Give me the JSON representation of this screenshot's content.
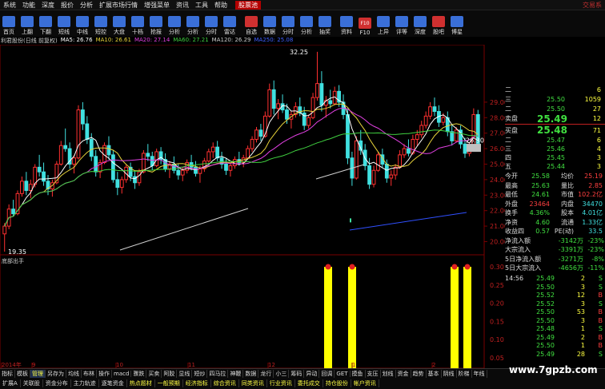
{
  "menu": {
    "items": [
      "系统",
      "功能",
      "深度",
      "报价",
      "分析",
      "扩展市场行情",
      "增强菜单",
      "资讯",
      "工具",
      "帮助"
    ],
    "active": "股票池",
    "right": "交易系"
  },
  "toolbar": {
    "buttons": [
      {
        "label": "首页",
        "icon": "home-icon",
        "color": "#3a6fd8"
      },
      {
        "label": "上翻",
        "icon": "arrow-up-icon",
        "color": "#3a6fd8"
      },
      {
        "label": "下翻",
        "icon": "arrow-down-icon",
        "color": "#3a6fd8"
      },
      {
        "label": "短线",
        "icon": "ruler-icon",
        "color": "#3a6fd8"
      },
      {
        "label": "中线",
        "icon": "chart-icon",
        "color": "#3a6fd8"
      },
      {
        "label": "短控",
        "icon": "chart-icon",
        "color": "#3a6fd8"
      },
      {
        "label": "大盘",
        "icon": "chart-icon",
        "color": "#3a6fd8"
      },
      {
        "label": "十档",
        "icon": "grid-icon",
        "color": "#3a6fd8"
      },
      {
        "label": "抢报",
        "icon": "flash-icon",
        "color": "#3a6fd8"
      },
      {
        "label": "分析",
        "icon": "kline-icon",
        "color": "#3a6fd8"
      },
      {
        "label": "分析",
        "icon": "pie-icon",
        "color": "#3a6fd8"
      },
      {
        "label": "分时",
        "icon": "clock-icon",
        "color": "#3a6fd8"
      },
      {
        "label": "雷达",
        "icon": "radar-icon",
        "color": "#3a6fd8"
      },
      {
        "label": "自选",
        "icon": "star-icon",
        "color": "#d03030"
      },
      {
        "label": "数据",
        "icon": "table-icon",
        "color": "#3a6fd8"
      },
      {
        "label": "分时",
        "icon": "clock-icon",
        "color": "#3a6fd8"
      },
      {
        "label": "分析",
        "icon": "kline-icon",
        "color": "#3a6fd8"
      },
      {
        "label": "抽奖",
        "icon": "gift-icon",
        "color": "#3a6fd8"
      },
      {
        "label": "资料",
        "icon": "doc-icon",
        "color": "#3a6fd8"
      },
      {
        "label": "F10",
        "icon": "f10-icon",
        "color": "#d03030"
      },
      {
        "label": "上异",
        "icon": "arrow-up-icon",
        "color": "#3a6fd8"
      },
      {
        "label": "评等",
        "icon": "rate-icon",
        "color": "#3a6fd8"
      },
      {
        "label": "深度",
        "icon": "depth-icon",
        "color": "#3a6fd8"
      },
      {
        "label": "股吧",
        "icon": "talk-icon",
        "color": "#d03030"
      },
      {
        "label": "博星",
        "icon": "star-icon",
        "color": "#3a6fd8"
      }
    ]
  },
  "ma_line": {
    "title": "利君股份(日线 前复权)",
    "items": [
      {
        "text": "MA5: 26.76",
        "color": "#ffffff"
      },
      {
        "text": "MA10: 26.61",
        "color": "#e6d23a"
      },
      {
        "text": "MA20: 27.14",
        "color": "#e040e0"
      },
      {
        "text": "MA60: 27.21",
        "color": "#40d040"
      },
      {
        "text": "MA120: 26.29",
        "color": "#cccccc"
      },
      {
        "text": "MA250: 25.08",
        "color": "#4060ff"
      }
    ]
  },
  "chart_data": {
    "type": "candlestick",
    "price_axis": [
      "29.00",
      "28.00",
      "27.00",
      "26.00",
      "25.00",
      "24.00",
      "23.00",
      "22.00",
      "21.00",
      "20.00"
    ],
    "price_min": 19.35,
    "price_max": 32.25,
    "annot_high": "32.25",
    "annot_low": "19.35",
    "annot_last": "26.30",
    "sub_indicator": "底部出手",
    "sub_axis": [
      "0.30",
      "0.25",
      "0.20",
      "0.15",
      "0.10",
      "0.05"
    ],
    "time_labels": [
      "2014年",
      "9",
      "10",
      "11",
      "12",
      "1",
      "2"
    ],
    "signal_bars": [
      0.3,
      0.3,
      0.3,
      0.3
    ],
    "candles": [
      [
        20.5,
        21.2,
        19.35,
        21.0
      ],
      [
        21.0,
        22.4,
        20.8,
        22.1
      ],
      [
        22.1,
        22.7,
        21.6,
        21.8
      ],
      [
        21.8,
        23.3,
        21.7,
        23.1
      ],
      [
        23.1,
        24.2,
        22.9,
        23.9
      ],
      [
        23.9,
        24.5,
        23.0,
        23.3
      ],
      [
        23.3,
        24.0,
        22.8,
        23.7
      ],
      [
        23.7,
        25.0,
        23.5,
        24.8
      ],
      [
        24.8,
        25.6,
        24.2,
        24.5
      ],
      [
        24.5,
        25.1,
        23.6,
        23.9
      ],
      [
        23.9,
        24.3,
        23.0,
        23.4
      ],
      [
        23.4,
        24.0,
        22.9,
        23.8
      ],
      [
        23.8,
        25.2,
        23.7,
        25.0
      ],
      [
        25.0,
        26.5,
        24.9,
        26.2
      ],
      [
        26.2,
        27.3,
        25.8,
        26.0
      ],
      [
        26.0,
        26.4,
        24.7,
        25.0
      ],
      [
        25.0,
        25.6,
        24.4,
        25.4
      ],
      [
        25.4,
        28.8,
        25.3,
        28.5
      ],
      [
        28.5,
        29.0,
        27.2,
        27.6
      ],
      [
        27.6,
        28.1,
        26.3,
        26.6
      ],
      [
        26.6,
        27.0,
        25.2,
        25.5
      ],
      [
        25.5,
        25.9,
        24.2,
        24.5
      ],
      [
        24.5,
        25.3,
        24.1,
        25.1
      ],
      [
        25.1,
        26.4,
        25.0,
        26.2
      ],
      [
        26.2,
        26.8,
        25.3,
        25.6
      ],
      [
        25.6,
        25.9,
        23.8,
        24.0
      ],
      [
        24.0,
        24.5,
        23.0,
        23.5
      ],
      [
        23.5,
        24.2,
        23.1,
        24.0
      ],
      [
        24.0,
        25.0,
        23.8,
        24.8
      ],
      [
        24.8,
        25.1,
        23.9,
        24.2
      ],
      [
        24.2,
        24.6,
        23.4,
        23.8
      ],
      [
        23.8,
        24.7,
        23.6,
        24.5
      ],
      [
        24.5,
        25.9,
        24.4,
        25.7
      ],
      [
        25.7,
        26.3,
        25.2,
        25.5
      ],
      [
        25.5,
        25.8,
        24.6,
        24.9
      ],
      [
        24.9,
        26.0,
        24.8,
        25.8
      ],
      [
        25.8,
        26.1,
        25.0,
        25.3
      ],
      [
        25.3,
        25.7,
        24.5,
        24.7
      ],
      [
        24.7,
        25.2,
        24.1,
        25.0
      ],
      [
        25.0,
        25.5,
        24.4,
        24.6
      ],
      [
        24.6,
        25.0,
        24.0,
        24.3
      ],
      [
        24.3,
        24.8,
        23.9,
        24.6
      ],
      [
        24.6,
        25.3,
        24.4,
        25.1
      ],
      [
        25.1,
        25.6,
        24.6,
        24.8
      ],
      [
        24.8,
        25.2,
        24.2,
        24.4
      ],
      [
        24.4,
        24.9,
        23.8,
        24.7
      ],
      [
        24.7,
        25.4,
        24.5,
        25.2
      ],
      [
        25.2,
        26.0,
        25.1,
        25.8
      ],
      [
        25.8,
        26.4,
        25.4,
        26.1
      ],
      [
        26.1,
        26.5,
        25.2,
        25.4
      ],
      [
        25.4,
        25.8,
        24.7,
        25.0
      ],
      [
        25.0,
        25.4,
        24.3,
        24.6
      ],
      [
        24.6,
        25.1,
        24.2,
        24.9
      ],
      [
        24.9,
        25.5,
        24.7,
        25.3
      ],
      [
        25.3,
        25.8,
        24.9,
        25.1
      ],
      [
        25.1,
        25.6,
        24.8,
        25.4
      ],
      [
        25.4,
        26.2,
        25.3,
        26.0
      ],
      [
        26.0,
        26.8,
        25.8,
        26.6
      ],
      [
        26.6,
        27.4,
        26.4,
        27.2
      ],
      [
        27.2,
        27.6,
        26.5,
        26.8
      ],
      [
        26.8,
        28.4,
        26.7,
        28.1
      ],
      [
        28.1,
        30.2,
        28.0,
        29.8
      ],
      [
        29.8,
        30.4,
        28.2,
        28.6
      ],
      [
        28.6,
        29.2,
        27.9,
        28.9
      ],
      [
        28.9,
        29.5,
        28.3,
        28.5
      ],
      [
        28.5,
        28.9,
        27.6,
        27.9
      ],
      [
        27.9,
        28.4,
        27.3,
        28.2
      ],
      [
        28.2,
        29.0,
        28.0,
        28.7
      ],
      [
        28.7,
        29.3,
        28.1,
        28.3
      ],
      [
        28.3,
        28.7,
        27.2,
        27.5
      ],
      [
        27.5,
        28.2,
        27.3,
        28.0
      ],
      [
        28.0,
        29.6,
        27.9,
        29.3
      ],
      [
        29.3,
        32.25,
        29.1,
        30.2
      ],
      [
        30.2,
        31.0,
        28.4,
        28.8
      ],
      [
        28.8,
        29.4,
        28.0,
        29.1
      ],
      [
        29.1,
        29.8,
        28.6,
        28.9
      ],
      [
        28.9,
        30.0,
        28.8,
        29.7
      ],
      [
        29.7,
        30.1,
        28.7,
        29.0
      ],
      [
        29.0,
        29.5,
        27.9,
        28.2
      ],
      [
        28.2,
        28.6,
        25.0,
        25.4
      ],
      [
        25.4,
        25.8,
        23.6,
        24.1
      ],
      [
        24.1,
        26.8,
        24.0,
        26.5
      ],
      [
        26.5,
        27.2,
        25.6,
        25.9
      ],
      [
        25.9,
        26.3,
        24.6,
        24.9
      ],
      [
        24.9,
        25.4,
        23.4,
        23.7
      ],
      [
        23.7,
        24.9,
        23.5,
        24.6
      ],
      [
        24.6,
        25.8,
        24.5,
        25.6
      ],
      [
        25.6,
        26.0,
        24.8,
        25.0
      ],
      [
        25.0,
        25.3,
        23.8,
        24.1
      ],
      [
        24.1,
        24.6,
        23.6,
        24.3
      ],
      [
        24.3,
        25.0,
        24.0,
        24.8
      ],
      [
        24.8,
        25.9,
        24.7,
        25.6
      ],
      [
        25.6,
        26.3,
        25.4,
        26.0
      ],
      [
        26.0,
        26.6,
        25.5,
        25.7
      ],
      [
        25.7,
        26.9,
        25.6,
        26.6
      ],
      [
        26.6,
        27.2,
        26.2,
        26.9
      ],
      [
        26.9,
        27.8,
        26.7,
        27.5
      ],
      [
        27.5,
        28.4,
        27.3,
        28.1
      ],
      [
        28.1,
        29.0,
        27.9,
        28.7
      ],
      [
        28.7,
        29.3,
        28.1,
        28.4
      ],
      [
        28.4,
        28.8,
        27.4,
        27.7
      ],
      [
        27.7,
        28.3,
        27.5,
        28.0
      ],
      [
        28.0,
        28.4,
        26.8,
        27.1
      ],
      [
        27.1,
        27.6,
        26.2,
        26.5
      ],
      [
        26.5,
        27.4,
        26.4,
        27.2
      ],
      [
        27.2,
        27.5,
        26.0,
        26.3
      ],
      [
        26.3,
        26.7,
        25.4,
        25.7
      ],
      [
        25.7,
        26.4,
        25.5,
        26.1
      ],
      [
        26.1,
        28.6,
        26.0,
        28.2
      ],
      [
        28.2,
        28.5,
        26.1,
        26.3
      ]
    ]
  },
  "quote": {
    "sell_rows": [
      {
        "lv": "二",
        "p": "",
        "v": "6"
      },
      {
        "lv": "三",
        "p": "25.50",
        "v": "1059"
      },
      {
        "lv": "二",
        "p": "25.50",
        "v": "27"
      }
    ],
    "sell_label": "卖盘",
    "sell_price": "25.49",
    "sell_vol": "12",
    "buy_label": "买盘",
    "buy_price": "25.48",
    "buy_vol": "71",
    "buy_rows": [
      {
        "lv": "二",
        "p": "25.47",
        "v": "6"
      },
      {
        "lv": "三",
        "p": "25.46",
        "v": "4"
      },
      {
        "lv": "四",
        "p": "25.45",
        "v": "3"
      },
      {
        "lv": "五",
        "p": "25.44",
        "v": "3"
      }
    ],
    "stats": [
      {
        "l1": "今开",
        "v1": "25.58",
        "l2": "均价",
        "v2": "25.19"
      },
      {
        "l1": "最高",
        "v1": "25.63",
        "l2": "量比",
        "v2": "2.85"
      },
      {
        "l1": "最低",
        "v1": "24.61",
        "l2": "市值",
        "v2": "102.2亿"
      },
      {
        "l1": "外盘",
        "v1": "23464",
        "l2": "内盘",
        "v2": "34470"
      },
      {
        "l1": "换手",
        "v1": "4.36%",
        "l2": "股本",
        "v2": "4.01亿"
      },
      {
        "l1": "净资",
        "v1": "4.60",
        "l2": "流通",
        "v2": "1.33亿"
      },
      {
        "l1": "收益四",
        "v1": "0.57",
        "l2": "PE(动)",
        "v2": "33.5"
      }
    ],
    "flows": [
      {
        "label": "净流入额",
        "val": "-3142万",
        "pct": "-23%"
      },
      {
        "label": "大宗流入",
        "val": "-3391万",
        "pct": "-23%"
      },
      {
        "label": "5日净流入额",
        "val": "-3271万",
        "pct": "-8%"
      },
      {
        "label": "5日大宗流入",
        "val": "-4656万",
        "pct": "-11%"
      }
    ],
    "ticks": [
      {
        "t": "14:56",
        "p": "25.49",
        "v": "2",
        "d": "S"
      },
      {
        "t": "",
        "p": "25.50",
        "v": "3",
        "d": "S"
      },
      {
        "t": "",
        "p": "25.52",
        "v": "12",
        "d": "B"
      },
      {
        "t": "",
        "p": "25.52",
        "v": "3",
        "d": "S"
      },
      {
        "t": "",
        "p": "25.50",
        "v": "53",
        "d": "B"
      },
      {
        "t": "",
        "p": "25.50",
        "v": "3",
        "d": "B"
      },
      {
        "t": "",
        "p": "25.48",
        "v": "1",
        "d": "S"
      },
      {
        "t": "",
        "p": "25.49",
        "v": "2",
        "d": "B"
      },
      {
        "t": "",
        "p": "25.50",
        "v": "1",
        "d": "B"
      },
      {
        "t": "",
        "p": "25.49",
        "v": "28",
        "d": "S"
      }
    ]
  },
  "tabs": {
    "items": [
      "指标",
      "模板",
      "管理",
      "另存为",
      "均线",
      "布林",
      "操作",
      "macd",
      "骤跌",
      "买卖",
      "阿胶",
      "显线",
      "短炒",
      "四马拉",
      "神鞭",
      "数据",
      "龙行",
      "小三",
      "筹码",
      "异动",
      "回调",
      "GET",
      "摸鱼",
      "支压",
      "划线",
      "资金",
      "趋势",
      "基本",
      "阴线",
      "阶梯",
      "年线"
    ],
    "active_index": 2
  },
  "bottom": {
    "items": [
      "扩展A",
      "关联股",
      "资金分布",
      "主力轨迹",
      "逐笔资金",
      "热点题材",
      "一般预期",
      "经济指标",
      "综合资讯",
      "同类资讯",
      "行业资讯",
      "委托成交",
      "持仓股份",
      "帐户资讯"
    ],
    "highlight": [
      5,
      6,
      7,
      8,
      9,
      10,
      11,
      12,
      13
    ]
  },
  "watermark": "www.7gpzb.com"
}
